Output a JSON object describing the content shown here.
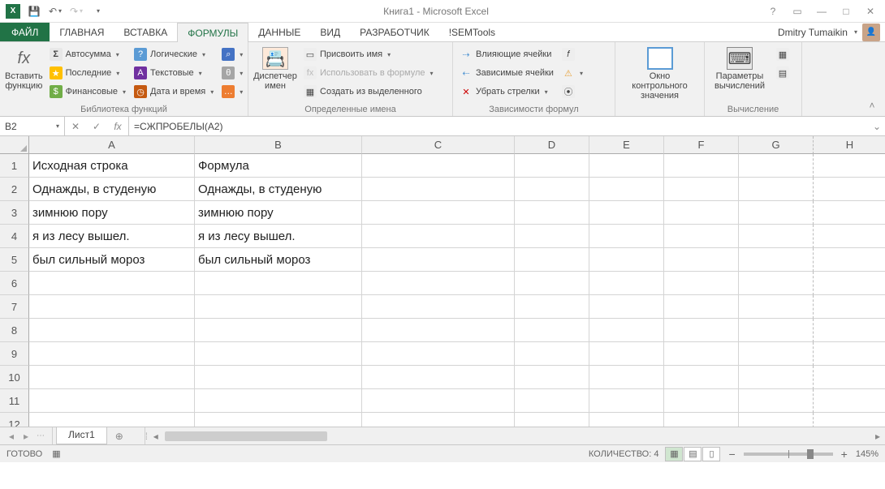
{
  "title": "Книга1 - Microsoft Excel",
  "user_name": "Dmitry Tumaikin",
  "tabs": {
    "file": "ФАЙЛ",
    "home": "ГЛАВНАЯ",
    "insert": "ВСТАВКА",
    "formulas": "ФОРМУЛЫ",
    "data": "ДАННЫЕ",
    "view": "ВИД",
    "developer": "РАЗРАБОТЧИК",
    "semtools": "!SEMTools"
  },
  "ribbon": {
    "insert_fn": "Вставить\nфункцию",
    "lib": {
      "autosum": "Автосумма",
      "recent": "Последние",
      "financial": "Финансовые",
      "logical": "Логические",
      "text": "Текстовые",
      "datetime": "Дата и время",
      "label": "Библиотека функций"
    },
    "name_mgr_btn": "Диспетчер\nимен",
    "names": {
      "define": "Присвоить имя",
      "use": "Использовать в формуле",
      "create": "Создать из выделенного",
      "label": "Определенные имена"
    },
    "audit": {
      "precedents": "Влияющие ячейки",
      "dependents": "Зависимые ячейки",
      "remove": "Убрать стрелки",
      "label": "Зависимости формул"
    },
    "watch": "Окно контрольного\nзначения",
    "calc": {
      "options": "Параметры\nвычислений",
      "label": "Вычисление"
    }
  },
  "namebox": "B2",
  "formula": "=СЖПРОБЕЛЫ(A2)",
  "cols": [
    "A",
    "B",
    "C",
    "D",
    "E",
    "F",
    "G",
    "H"
  ],
  "row_numbers": [
    "1",
    "2",
    "3",
    "4",
    "5",
    "6",
    "7",
    "8",
    "9",
    "10",
    "11",
    "12"
  ],
  "cells": {
    "A1": "Исходная строка",
    "B1": "Формула",
    "A2": "   Однажды, в студеную",
    "B2": "Однажды, в студеную",
    "A3": " зимнюю пору",
    "B3": "зимнюю пору",
    "A4": " я из лесу вышел.",
    "B4": "я из лесу вышел.",
    "A5": " был сильный мороз",
    "B5": "был сильный мороз"
  },
  "sheet_tab": "Лист1",
  "status": {
    "ready": "ГОТОВО",
    "count_label": "КОЛИЧЕСТВО:",
    "count_value": "4",
    "zoom": "145%"
  }
}
